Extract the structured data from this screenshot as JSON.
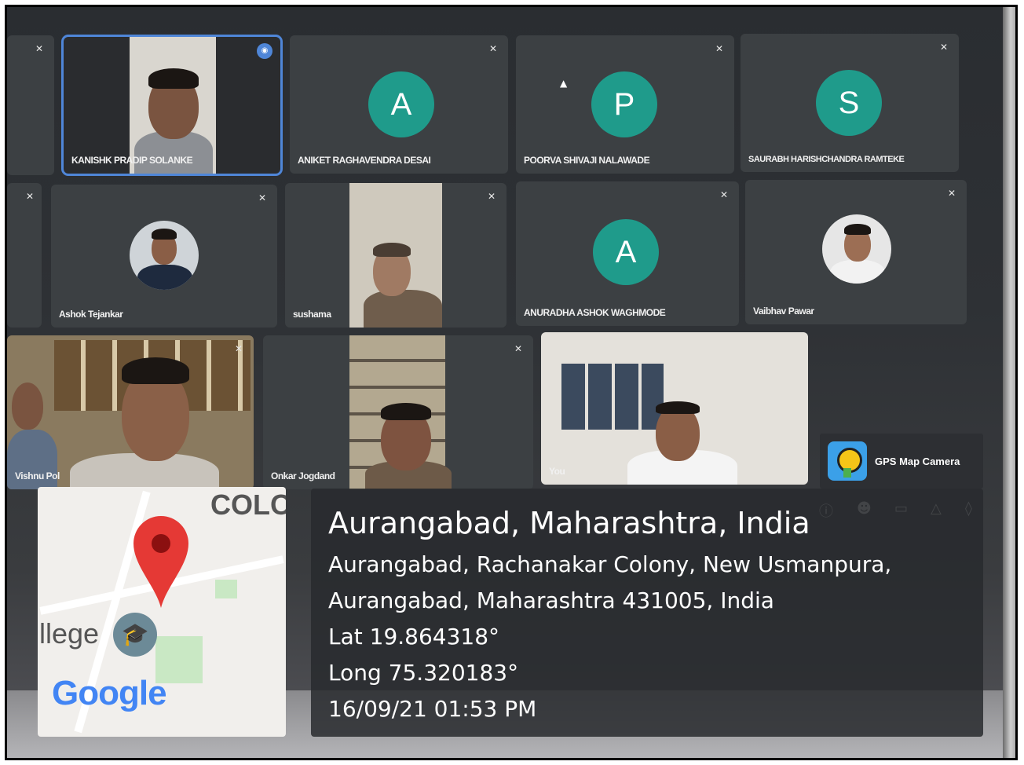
{
  "meeting": {
    "participants": [
      {
        "name": "KANISHK PRADIP SOLANKE",
        "type": "video",
        "active": true
      },
      {
        "name": "ANIKET RAGHAVENDRA DESAI",
        "type": "avatar",
        "initial": "A"
      },
      {
        "name": "POORVA SHIVAJI NALAWADE",
        "type": "avatar",
        "initial": "P"
      },
      {
        "name": "SAURABH HARISHCHANDRA RAMTEKE",
        "type": "avatar",
        "initial": "S"
      },
      {
        "name": "Ashok Tejankar",
        "type": "photo"
      },
      {
        "name": "sushama",
        "type": "video"
      },
      {
        "name": "ANURADHA ASHOK WAGHMODE",
        "type": "avatar",
        "initial": "A"
      },
      {
        "name": "Vaibhav Pawar",
        "type": "photo"
      },
      {
        "name": "Vishnu Pol",
        "type": "video"
      },
      {
        "name": "Onkar Jogdand",
        "type": "video"
      },
      {
        "name": "You",
        "type": "video"
      }
    ]
  },
  "gps_overlay": {
    "app_name": "GPS Map Camera",
    "map_label_colony": "COLO",
    "map_label_college": "llege",
    "map_brand": "Google",
    "title": "Aurangabad, Maharashtra, India",
    "address_line1": "Aurangabad, Rachanakar Colony, New Usmanpura,",
    "address_line2": "Aurangabad, Maharashtra 431005, India",
    "latitude": "Lat 19.864318°",
    "longitude": "Long 75.320183°",
    "datetime": "16/09/21 01:53 PM"
  },
  "colors": {
    "avatar": "#1f9b8b",
    "active_border": "#4f86d8",
    "pin": "#e53935",
    "overlay": "#282a2e"
  },
  "icons": [
    "mic-off-icon",
    "map-pin-icon",
    "graduation-cap-icon",
    "camera-lens-icon"
  ]
}
